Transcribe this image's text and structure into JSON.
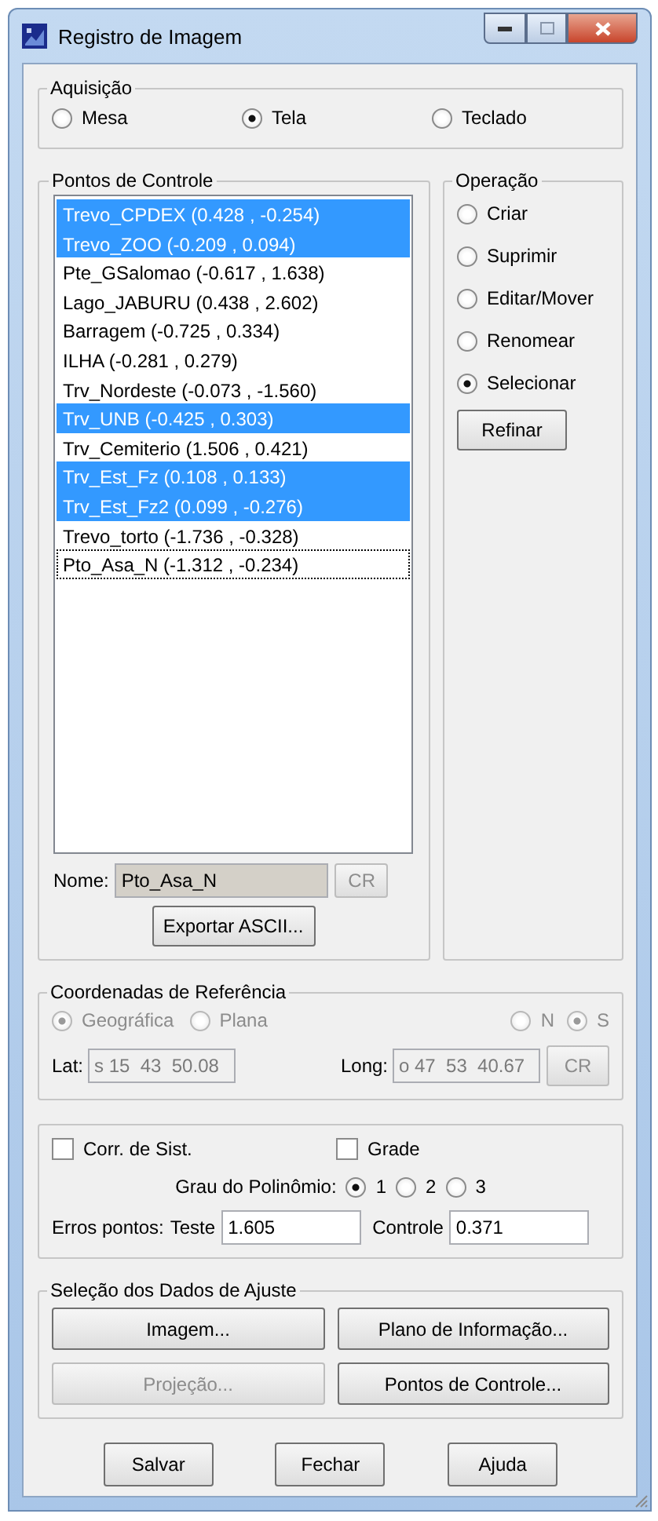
{
  "window": {
    "title": "Registro de Imagem"
  },
  "aquisicao": {
    "title": "Aquisição",
    "options": [
      {
        "label": "Mesa",
        "selected": false
      },
      {
        "label": "Tela",
        "selected": true
      },
      {
        "label": "Teclado",
        "selected": false
      }
    ]
  },
  "pontos": {
    "title": "Pontos de Controle",
    "items": [
      {
        "label": "Trevo_CPDEX (0.428 , -0.254)",
        "selected": true,
        "focused": false
      },
      {
        "label": "Trevo_ZOO (-0.209 , 0.094)",
        "selected": true,
        "focused": false
      },
      {
        "label": "Pte_GSalomao (-0.617 , 1.638)",
        "selected": false,
        "focused": false
      },
      {
        "label": "Lago_JABURU (0.438 , 2.602)",
        "selected": false,
        "focused": false
      },
      {
        "label": "Barragem (-0.725 , 0.334)",
        "selected": false,
        "focused": false
      },
      {
        "label": "ILHA (-0.281 , 0.279)",
        "selected": false,
        "focused": false
      },
      {
        "label": "Trv_Nordeste (-0.073 , -1.560)",
        "selected": false,
        "focused": false
      },
      {
        "label": "Trv_UNB (-0.425 , 0.303)",
        "selected": true,
        "focused": false
      },
      {
        "label": "Trv_Cemiterio (1.506 , 0.421)",
        "selected": false,
        "focused": false
      },
      {
        "label": "Trv_Est_Fz (0.108 , 0.133)",
        "selected": true,
        "focused": false
      },
      {
        "label": "Trv_Est_Fz2 (0.099 , -0.276)",
        "selected": true,
        "focused": false
      },
      {
        "label": "Trevo_torto (-1.736 , -0.328)",
        "selected": false,
        "focused": false
      },
      {
        "label": "Pto_Asa_N (-1.312 , -0.234)",
        "selected": false,
        "focused": true
      }
    ],
    "name_label": "Nome:",
    "name_value": "Pto_Asa_N",
    "cr_button": {
      "label": "CR",
      "disabled": true
    },
    "export_button": "Exportar ASCII..."
  },
  "operacao": {
    "title": "Operação",
    "options": [
      {
        "label": "Criar",
        "selected": false
      },
      {
        "label": "Suprimir",
        "selected": false
      },
      {
        "label": "Editar/Mover",
        "selected": false
      },
      {
        "label": "Renomear",
        "selected": false
      },
      {
        "label": "Selecionar",
        "selected": true
      }
    ],
    "refine_button": "Refinar"
  },
  "coordenadas": {
    "title": "Coordenadas de Referência",
    "disabled": true,
    "system": [
      {
        "label": "Geográfica",
        "selected": true
      },
      {
        "label": "Plana",
        "selected": false
      }
    ],
    "hemisphere": [
      {
        "label": "N",
        "selected": false
      },
      {
        "label": "S",
        "selected": true
      }
    ],
    "lat_label": "Lat:",
    "lat_value": "s 15  43  50.08",
    "long_label": "Long:",
    "long_value": "o 47  53  40.67",
    "cr_button": {
      "label": "CR",
      "disabled": true
    }
  },
  "ajuste": {
    "checks": [
      {
        "label": "Corr. de Sist.",
        "checked": false
      },
      {
        "label": "Grade",
        "checked": false
      }
    ],
    "degree_label": "Grau do Polinômio:",
    "degrees": [
      {
        "label": "1",
        "selected": true
      },
      {
        "label": "2",
        "selected": false
      },
      {
        "label": "3",
        "selected": false
      }
    ],
    "errors_label": "Erros pontos:",
    "test_label": "Teste",
    "test_value": "1.605",
    "control_label": "Controle",
    "control_value": "0.371"
  },
  "selecao": {
    "title": "Seleção dos Dados de Ajuste",
    "buttons": [
      {
        "label": "Imagem...",
        "disabled": false
      },
      {
        "label": "Plano de Informação...",
        "disabled": false
      },
      {
        "label": "Projeção...",
        "disabled": true
      },
      {
        "label": "Pontos de Controle...",
        "disabled": false
      }
    ]
  },
  "buttons": [
    "Salvar",
    "Fechar",
    "Ajuda"
  ]
}
